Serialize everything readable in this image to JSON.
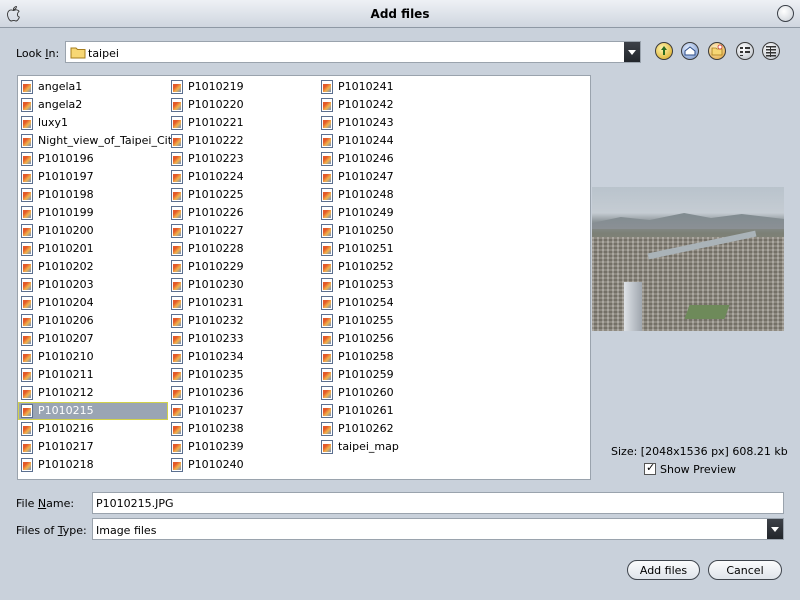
{
  "window": {
    "title": "Add files"
  },
  "look_in": {
    "label_prefix": "Look ",
    "label_key": "I",
    "label_suffix": "n:",
    "value": "taipei"
  },
  "toolbar": {
    "icons": [
      "up-folder-icon",
      "home-icon",
      "new-folder-icon",
      "list-view-icon",
      "details-view-icon"
    ]
  },
  "files": {
    "col1": [
      "angela1",
      "angela2",
      "luxy1",
      "Night_view_of_Taipei_City",
      "P1010196",
      "P1010197",
      "P1010198",
      "P1010199",
      "P1010200",
      "P1010201",
      "P1010202",
      "P1010203",
      "P1010204",
      "P1010206",
      "P1010207",
      "P1010210",
      "P1010211",
      "P1010212",
      "P1010215",
      "P1010216",
      "P1010217",
      "P1010218"
    ],
    "col2": [
      "P1010219",
      "P1010220",
      "P1010221",
      "P1010222",
      "P1010223",
      "P1010224",
      "P1010225",
      "P1010226",
      "P1010227",
      "P1010228",
      "P1010229",
      "P1010230",
      "P1010231",
      "P1010232",
      "P1010233",
      "P1010234",
      "P1010235",
      "P1010236",
      "P1010237",
      "P1010238",
      "P1010239",
      "P1010240"
    ],
    "col3": [
      "P1010241",
      "P1010242",
      "P1010243",
      "P1010244",
      "P1010246",
      "P1010247",
      "P1010248",
      "P1010249",
      "P1010250",
      "P1010251",
      "P1010252",
      "P1010253",
      "P1010254",
      "P1010255",
      "P1010256",
      "P1010258",
      "P1010259",
      "P1010260",
      "P1010261",
      "P1010262",
      "taipei_map"
    ],
    "selected": "P1010215"
  },
  "preview": {
    "size_text": "Size: [2048x1536 px] 608.21 kb",
    "show_preview_label": "Show Preview",
    "show_preview_checked": true
  },
  "file_name": {
    "label_prefix": "File ",
    "label_key": "N",
    "label_suffix": "ame:",
    "value": "P1010215.JPG"
  },
  "file_type": {
    "label_prefix": "Files of ",
    "label_key": "T",
    "label_suffix": "ype:",
    "value": "Image files"
  },
  "buttons": {
    "add": "Add files",
    "cancel": "Cancel"
  }
}
